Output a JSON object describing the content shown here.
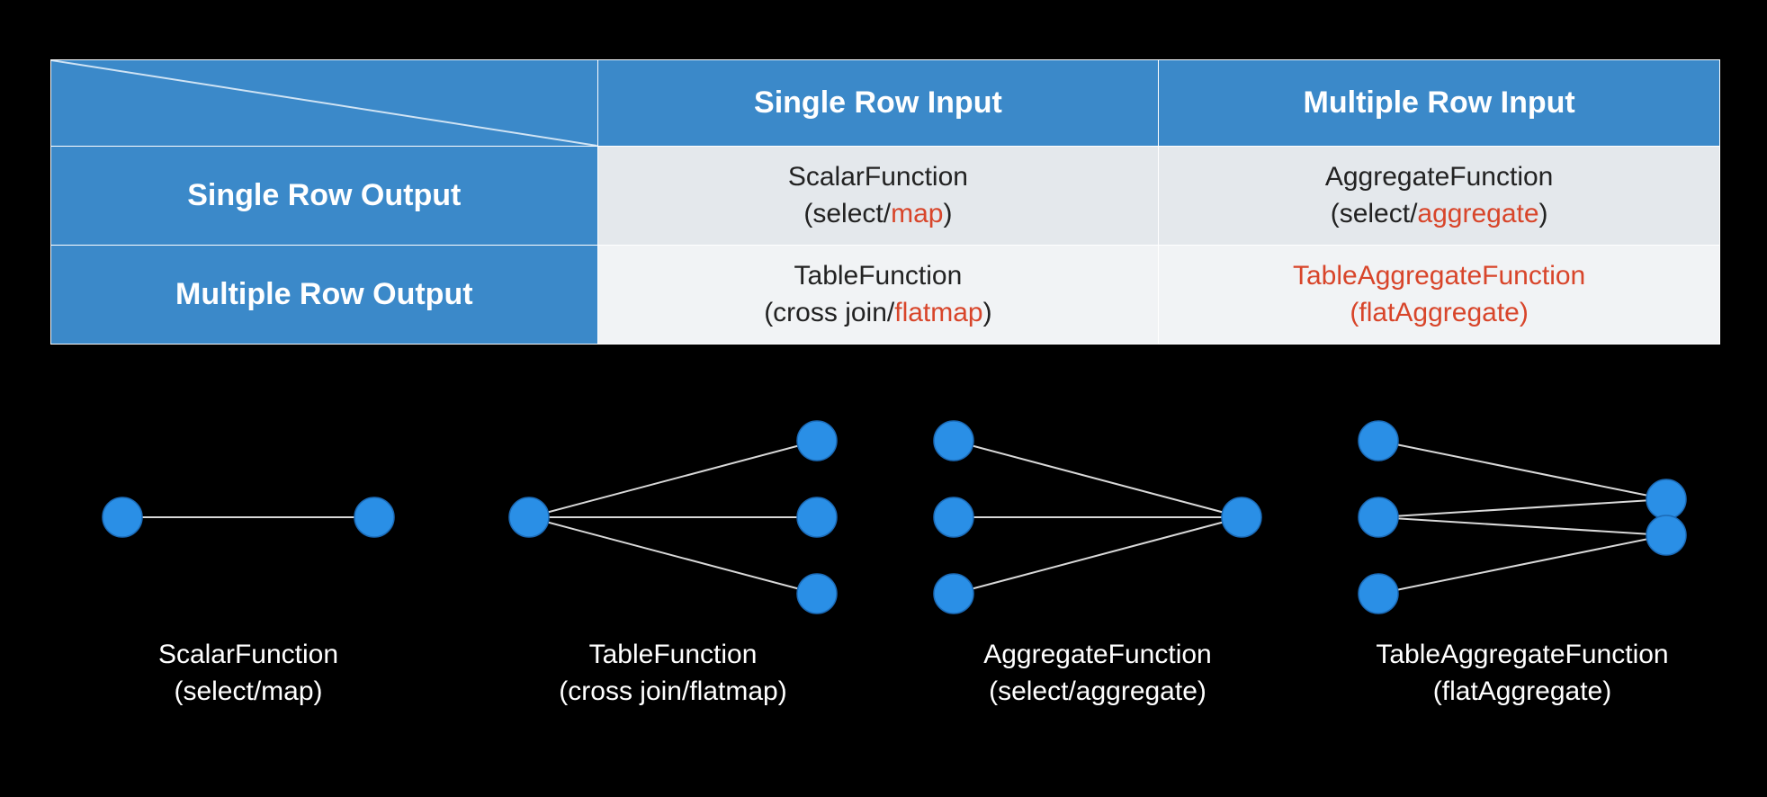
{
  "table": {
    "col_headers": [
      "Single Row Input",
      "Multiple Row Input"
    ],
    "row_headers": [
      "Single Row Output",
      "Multiple Row Output"
    ],
    "cells": {
      "r0c0": {
        "line1": "ScalarFunction",
        "prefix": "(select/",
        "red": "map",
        "suffix": ")"
      },
      "r0c1": {
        "line1": "AggregateFunction",
        "prefix": "(select/",
        "red": "aggregate",
        "suffix": ")"
      },
      "r1c0": {
        "line1": "TableFunction",
        "prefix": "(cross join/",
        "red": "flatmap",
        "suffix": ")"
      },
      "r1c1": {
        "line1_red": "TableAggregateFunction",
        "line2_red": "(flatAggregate)"
      }
    }
  },
  "diagrams": [
    {
      "title_l1": "ScalarFunction",
      "title_l2": "(select/map)"
    },
    {
      "title_l1": "TableFunction",
      "title_l2": "(cross join/flatmap)"
    },
    {
      "title_l1": "AggregateFunction",
      "title_l2": "(select/aggregate)"
    },
    {
      "title_l1": "TableAggregateFunction",
      "title_l2": "(flatAggregate)"
    }
  ],
  "colors": {
    "header_bg": "#3b89c9",
    "red": "#d8452a",
    "node": "#2a8fe6"
  }
}
